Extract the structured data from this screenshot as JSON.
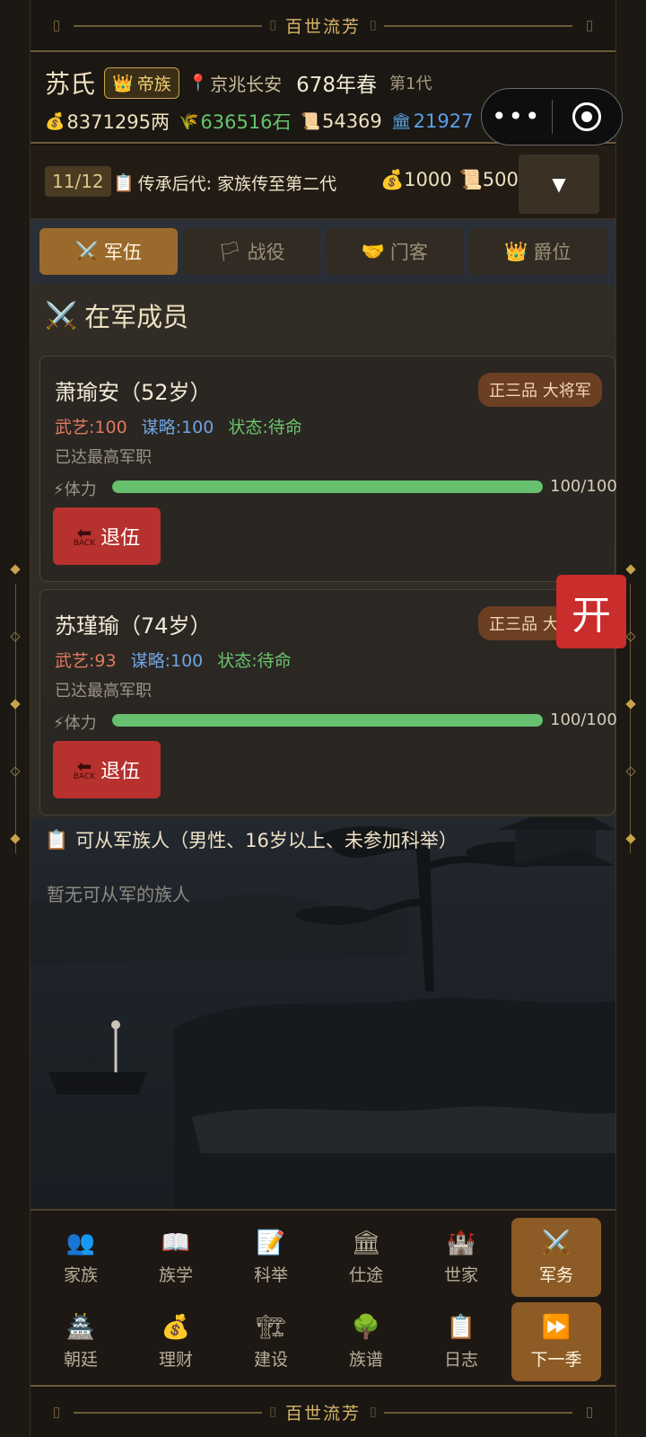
{
  "banner": {
    "title": "百世流芳"
  },
  "header": {
    "clan_name": "苏氏",
    "rank_badge": "帝族",
    "location": "京兆长安",
    "year": "678年春",
    "generation": "第1代",
    "money": "8371295两",
    "grain": "636516石",
    "scrolls": "54369",
    "prestige": "21927"
  },
  "capsule": {
    "more_icon": "more-icon",
    "close_icon": "target-close-icon"
  },
  "task": {
    "count": "11/12",
    "text": "传承后代: 家族传至第二代",
    "reward_money": "1000",
    "reward_scroll": "500",
    "toggle": "▼"
  },
  "tabs": [
    {
      "label": "军伍",
      "icon": "⚔️",
      "active": true
    },
    {
      "label": "战役",
      "icon": "🏳",
      "active": false
    },
    {
      "label": "门客",
      "icon": "🤝",
      "active": false
    },
    {
      "label": "爵位",
      "icon": "👑",
      "active": false
    }
  ],
  "section": {
    "title": "在军成员",
    "icon": "⚔️"
  },
  "members": [
    {
      "name": "萧瑜安（52岁）",
      "rank": "正三品 大将军",
      "wuyi": "武艺:100",
      "moulue": "谋略:100",
      "status": "状态:待命",
      "note": "已达最高军职",
      "stamina_label": "⚡体力",
      "stamina_value": "100/100",
      "stamina_fraction": 1.0,
      "retire_label": "退伍",
      "back_text": "BACK"
    },
    {
      "name": "苏瑾瑜（74岁）",
      "rank": "正三品 大将军",
      "wuyi": "武艺:93",
      "moulue": "谋略:100",
      "status": "状态:待命",
      "note": "已达最高军职",
      "stamina_label": "⚡体力",
      "stamina_value": "100/100",
      "stamina_fraction": 1.0,
      "retire_label": "退伍",
      "back_text": "BACK"
    }
  ],
  "open_button": "开",
  "eligible": {
    "title": "可从军族人（男性、16岁以上、未参加科举）",
    "empty": "暂无可从军的族人"
  },
  "nav": [
    {
      "label": "家族",
      "icon": "👥",
      "active": false
    },
    {
      "label": "族学",
      "icon": "📖",
      "active": false
    },
    {
      "label": "科举",
      "icon": "📝",
      "active": false
    },
    {
      "label": "仕途",
      "icon": "🏛",
      "active": false
    },
    {
      "label": "世家",
      "icon": "🏰",
      "active": false
    },
    {
      "label": "军务",
      "icon": "⚔️",
      "active": true
    },
    {
      "label": "朝廷",
      "icon": "🏯",
      "active": false
    },
    {
      "label": "理财",
      "icon": "💰",
      "active": false
    },
    {
      "label": "建设",
      "icon": "🏗",
      "active": false
    },
    {
      "label": "族谱",
      "icon": "🌳",
      "active": false
    },
    {
      "label": "日志",
      "icon": "📋",
      "active": false
    },
    {
      "label": "下一季",
      "icon": "⏩",
      "active": true
    }
  ]
}
